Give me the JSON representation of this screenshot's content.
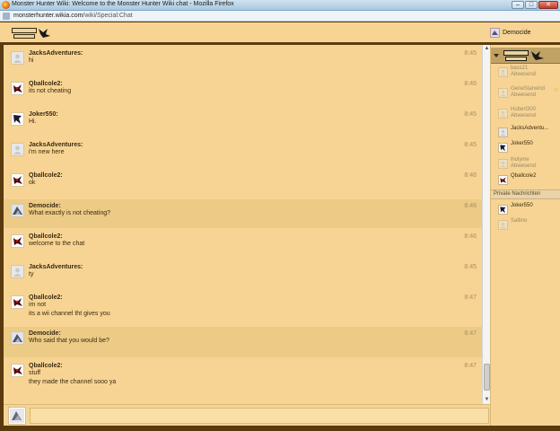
{
  "window": {
    "title": "Monster Hunter Wiki: Welcome to the Monster Hunter Wiki chat - Mozilla Firefox",
    "controls": [
      "–",
      "□",
      "✕"
    ]
  },
  "address": {
    "host": "monsterhunter.wikia.com",
    "path": "/wiki/Special:Chat"
  },
  "header": {
    "current_user": "Democide"
  },
  "messages": [
    {
      "user": "JacksAdventures:",
      "lines": [
        "hi"
      ],
      "time": "8:45",
      "avatar": "default-avatar"
    },
    {
      "user": "Qballcole2:",
      "lines": [
        "its not cheating"
      ],
      "time": "8:46",
      "avatar": "rathalos-avatar"
    },
    {
      "user": "Joker550:",
      "lines": [
        "Hi."
      ],
      "time": "8:45",
      "avatar": "joker-avatar"
    },
    {
      "user": "JacksAdventures:",
      "lines": [
        "i'm new here"
      ],
      "time": "8:45",
      "avatar": "default-avatar"
    },
    {
      "user": "Qballcole2:",
      "lines": [
        "ok"
      ],
      "time": "8:46",
      "avatar": "rathalos-avatar"
    },
    {
      "user": "Democide:",
      "lines": [
        "What exactly is not cheating?"
      ],
      "time": "8:46",
      "avatar": "democide-avatar",
      "highlight": true
    },
    {
      "user": "Qballcole2:",
      "lines": [
        "welcome to the chat"
      ],
      "time": "8:46",
      "avatar": "rathalos-avatar"
    },
    {
      "user": "JacksAdventures:",
      "lines": [
        "ty"
      ],
      "time": "8:45",
      "avatar": "default-avatar"
    },
    {
      "user": "Qballcole2:",
      "lines": [
        "im not",
        "its a wii channel tht gives you"
      ],
      "time": "8:47",
      "avatar": "rathalos-avatar"
    },
    {
      "user": "Democide:",
      "lines": [
        "Who said that you would be?"
      ],
      "time": "8:47",
      "avatar": "democide-avatar",
      "highlight": true
    },
    {
      "user": "Qballcole2:",
      "lines": [
        "stuff",
        "they made the channel sooo ya"
      ],
      "time": "8:47",
      "avatar": "rathalos-avatar"
    }
  ],
  "sidebar": {
    "users": [
      {
        "name": "bass21",
        "status": "Abwesend",
        "away": true
      },
      {
        "name": "GeneStarwind",
        "status": "Abwesend",
        "away": true,
        "star": "☆"
      },
      {
        "name": "Hubert300",
        "status": "Abwesend",
        "away": true
      },
      {
        "name": "JacksAdventu...",
        "status": "",
        "away": false
      },
      {
        "name": "Joker550",
        "status": "",
        "away": false
      },
      {
        "name": "lholyme",
        "status": "Abwesend",
        "away": true
      },
      {
        "name": "Qballcole2",
        "status": "",
        "away": false
      }
    ],
    "private_heading": "Private Nachrichten",
    "private": [
      {
        "name": "Joker550",
        "status": "",
        "away": false
      },
      {
        "name": "Saltino",
        "status": "",
        "away": true
      }
    ]
  },
  "input": {
    "value": ""
  },
  "colors": {
    "background": "#f7d493",
    "highlight": "#eccb86",
    "frame": "#5a3a0e"
  }
}
